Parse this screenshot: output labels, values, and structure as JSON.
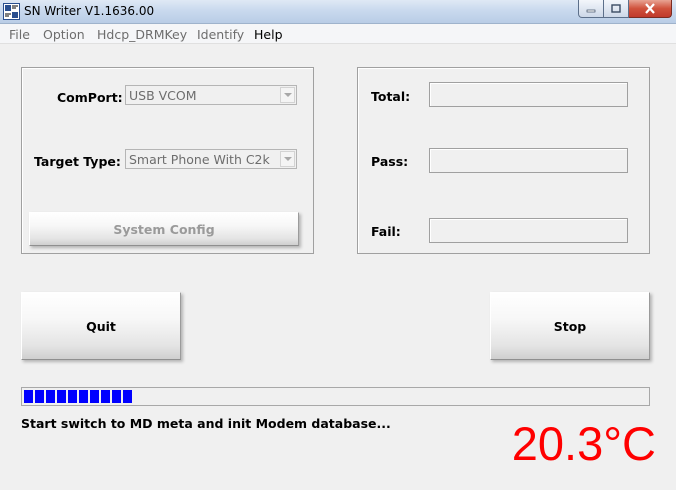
{
  "window": {
    "title": "SN Writer V1.1636.00"
  },
  "menu": {
    "items": [
      {
        "label": "File",
        "enabled": false
      },
      {
        "label": "Option",
        "enabled": false
      },
      {
        "label": "Hdcp_DRMKey",
        "enabled": false
      },
      {
        "label": "Identify",
        "enabled": false
      },
      {
        "label": "Help",
        "enabled": true
      }
    ]
  },
  "config": {
    "comport_label": "ComPort:",
    "comport_value": "USB VCOM",
    "target_type_label": "Target Type:",
    "target_type_value": "Smart Phone With C2k",
    "system_config_label": "System Config"
  },
  "stats": {
    "total_label": "Total:",
    "pass_label": "Pass:",
    "fail_label": "Fail:",
    "total_value": "",
    "pass_value": "",
    "fail_value": ""
  },
  "actions": {
    "quit_label": "Quit",
    "stop_label": "Stop"
  },
  "progress": {
    "segments_filled": 10,
    "color": "#0000ff"
  },
  "status": {
    "message": "Start switch to MD meta and init Modem database...",
    "temperature": "20.3°C",
    "temperature_color": "#ff0000"
  }
}
